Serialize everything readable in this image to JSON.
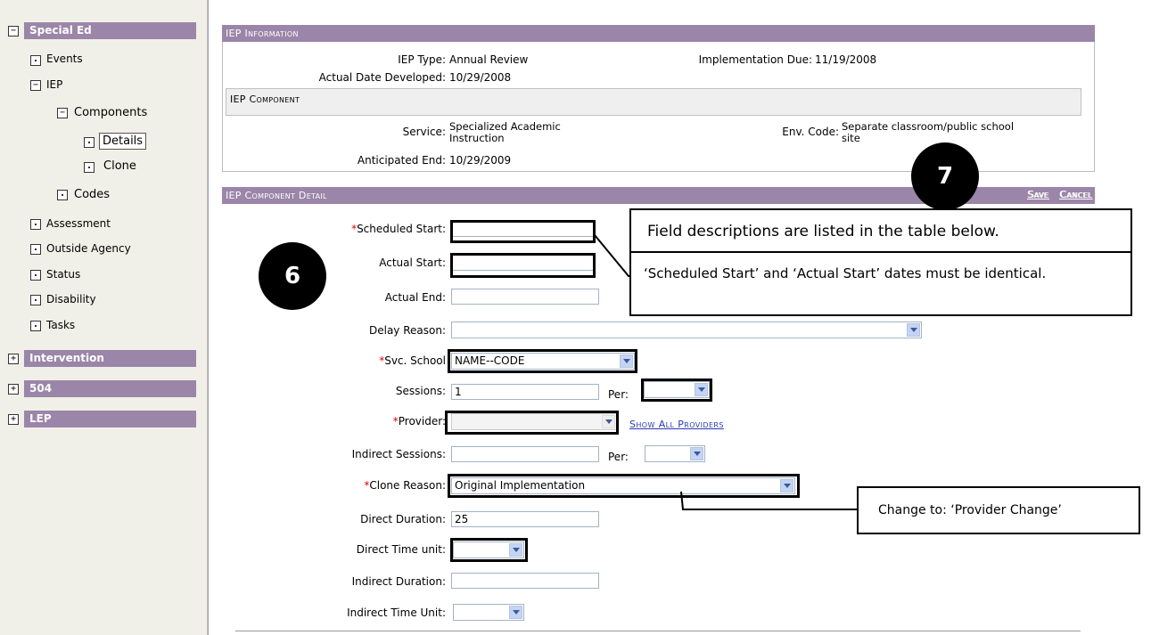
{
  "sidebar": {
    "special_ed": "Special Ed",
    "events": "Events",
    "iep": "IEP",
    "components": "Components",
    "details": "Details",
    "clone": "Clone",
    "codes": "Codes",
    "assessment": "Assessment",
    "outside_agency": "Outside Agency",
    "status": "Status",
    "disability": "Disability",
    "tasks": "Tasks",
    "intervention": "Intervention",
    "s504": "504",
    "lep": "LEP",
    "collapse_symbol": "−",
    "expand_symbol": "+"
  },
  "iep_info": {
    "header": "IEP Information",
    "iep_type_label": "IEP Type:",
    "iep_type_value": "Annual Review",
    "impl_due_label": "Implementation Due:",
    "impl_due_value": "11/19/2008",
    "actual_date_label": "Actual Date Developed:",
    "actual_date_value": "10/29/2008",
    "component_header": "IEP Component",
    "service_label": "Service:",
    "service_value_1": "Specialized Academic",
    "service_value_2": "Instruction",
    "env_code_label": "Env. Code:",
    "env_code_value_1": "Separate classroom/public school",
    "env_code_value_2": "site",
    "anticipated_end_label": "Anticipated End:",
    "anticipated_end_value": "10/29/2009"
  },
  "detail": {
    "header": "IEP Component Detail",
    "save": "Save",
    "cancel": "Cancel",
    "required_mark": "*",
    "scheduled_start_label": "Scheduled Start:",
    "actual_start_label": "Actual Start:",
    "actual_end_label": "Actual End:",
    "delay_reason_label": "Delay Reason:",
    "svc_school_label": "Svc. School",
    "svc_school_value": "NAME--CODE",
    "sessions_label": "Sessions:",
    "sessions_value": "1",
    "per_label": "Per:",
    "provider_label": "Provider:",
    "show_all_providers": "Show All Providers",
    "indirect_sessions_label": "Indirect Sessions:",
    "indirect_per_label": "Per:",
    "clone_reason_label": "Clone Reason:",
    "clone_reason_value": "Original Implementation",
    "direct_duration_label": "Direct Duration:",
    "direct_duration_value": "25",
    "direct_time_unit_label": "Direct Time unit:",
    "indirect_duration_label": "Indirect Duration:",
    "indirect_time_unit_label": "Indirect Time Unit:"
  },
  "annotations": {
    "step6": "6",
    "step7": "7",
    "field_desc": "Field descriptions are listed in the table below.",
    "dates_note": "‘Scheduled Start’ and ‘Actual Start’ dates must be identical.",
    "change_note": "Change to: ‘Provider Change’"
  }
}
